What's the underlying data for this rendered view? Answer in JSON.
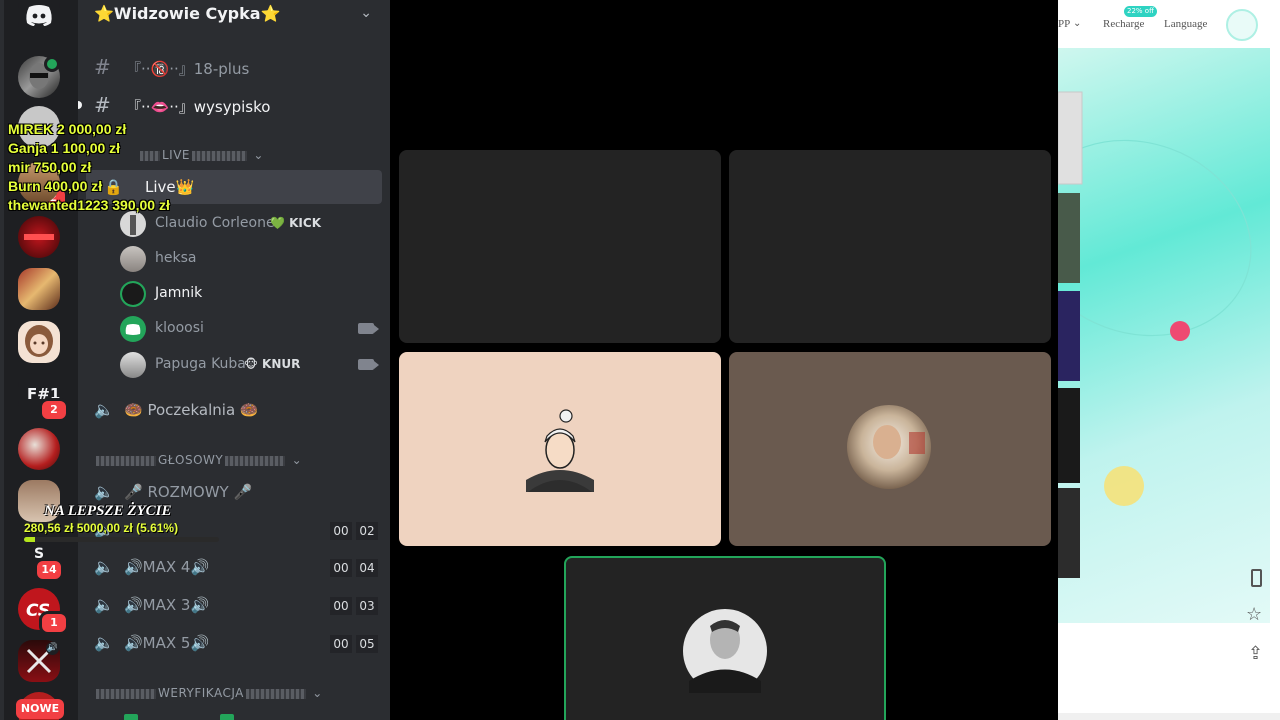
{
  "rail": {
    "new_label": "NOWE",
    "badges": {
      "fsharp": "2",
      "s14": "14",
      "c1": "1",
      "r2": "2"
    },
    "fsharp_label": "F#1",
    "s_letter": "S"
  },
  "server": {
    "name": "⭐Widzowie Cypka⭐",
    "channels": [
      {
        "name": "『··🔞··』18-plus"
      },
      {
        "name": "『··👄··』wysypisko"
      }
    ],
    "cat_live": "LIVE",
    "live_channel": "Live👑",
    "users": [
      {
        "name": "Claudio Corleone",
        "tag": "💚 KICK"
      },
      {
        "name": "heksa"
      },
      {
        "name": "Jamnik"
      },
      {
        "name": "klooosi"
      },
      {
        "name": "Papuga Kuba",
        "tag": "🐵 KNUR"
      }
    ],
    "waiting": "🍩 Poczekalnia 🍩",
    "cat_voice": "GŁOSOWY",
    "voice_channels": [
      {
        "name": "🎤 ROZMOWY 🎤"
      },
      {
        "name": "",
        "a": "00",
        "b": "02"
      },
      {
        "name": "🔊MAX 4🔊",
        "a": "00",
        "b": "04"
      },
      {
        "name": "🔊MAX 3🔊",
        "a": "00",
        "b": "03"
      },
      {
        "name": "🔊MAX 5🔊",
        "a": "00",
        "b": "05"
      }
    ],
    "cat_verify": "WERYFIKACJA"
  },
  "donations": [
    "MIREK  2 000,00 zł",
    "Ganja  1 100,00 zł",
    "mir  750,00 zł",
    "Burn  400,00 zł",
    "thewanted1223  390,00 zł"
  ],
  "goal": {
    "title": "NA LEPSZE ŻYCIE",
    "amount": "280,56 zł  5000,00 zł (5.61%)",
    "fraction": 0.0561
  },
  "web": {
    "pp": "PP",
    "recharge": "Recharge",
    "language": "Language",
    "promo": "22% off"
  },
  "colors": {
    "rail_bg": "#1e1f22",
    "channel_bg": "#2b2d31",
    "selected": "#404249",
    "tile_dark": "#232323",
    "tile_peach": "#efd3c0",
    "tile_brown": "#6a5a4f",
    "speaking_border": "#23a55a",
    "donation_text": "#e6ff3a"
  }
}
